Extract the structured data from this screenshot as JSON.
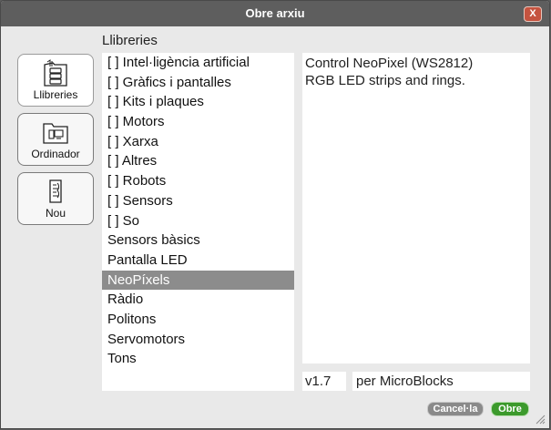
{
  "dialog": {
    "title": "Obre arxiu",
    "close_label": "X",
    "section_label": "Llibreries"
  },
  "sidebar": {
    "buttons": [
      {
        "label": "Llibreries",
        "icon": "library-icon",
        "selected": true
      },
      {
        "label": "Ordinador",
        "icon": "computer-folder-icon",
        "selected": false
      },
      {
        "label": "Nou",
        "icon": "new-file-icon",
        "selected": false
      }
    ]
  },
  "list": {
    "items": [
      "[ ] Intel·ligència artificial",
      "[ ] Gràfics i pantalles",
      "[ ] Kits i plaques",
      "[ ] Motors",
      "[ ] Xarxa",
      "[ ] Altres",
      "[ ] Robots",
      "[ ] Sensors",
      "[ ] So",
      "Sensors bàsics",
      "Pantalla LED",
      "NeoPíxels",
      "Ràdio",
      "Politons",
      "Servomotors",
      "Tons"
    ],
    "selected": "NeoPíxels"
  },
  "description": {
    "line1": "Control NeoPixel (WS2812)",
    "line2": "RGB LED strips and rings."
  },
  "meta": {
    "version": "v1.7",
    "author": "per MicroBlocks"
  },
  "footer": {
    "cancel_label": "Cancel·la",
    "open_label": "Obre"
  },
  "colors": {
    "titlebar": "#5e5e5e",
    "close": "#c5533f",
    "selection": "#8c8c8c",
    "open_button": "#3c9a2c",
    "cancel_button": "#8a8a8a"
  }
}
